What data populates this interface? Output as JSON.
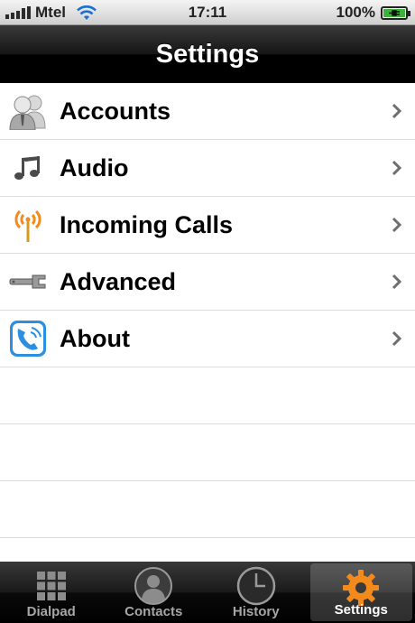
{
  "status_bar": {
    "carrier": "Mtel",
    "time": "17:11",
    "battery": "100%",
    "battery_level": 1.0,
    "signal_bars": 5,
    "icons": [
      "signal-icon",
      "wifi-icon",
      "battery-charging-icon"
    ]
  },
  "navbar": {
    "title": "Settings"
  },
  "settings": {
    "items": [
      {
        "label": "Accounts",
        "icon": "accounts-icon"
      },
      {
        "label": "Audio",
        "icon": "music-note-icon"
      },
      {
        "label": "Incoming Calls",
        "icon": "antenna-icon"
      },
      {
        "label": "Advanced",
        "icon": "wrench-icon"
      },
      {
        "label": "About",
        "icon": "app-phone-icon"
      }
    ]
  },
  "tabbar": {
    "tabs": [
      {
        "label": "Dialpad",
        "icon": "dialpad-icon",
        "active": false
      },
      {
        "label": "Contacts",
        "icon": "contacts-icon",
        "active": false
      },
      {
        "label": "History",
        "icon": "clock-icon",
        "active": false
      },
      {
        "label": "Settings",
        "icon": "gear-icon",
        "active": true
      }
    ]
  },
  "colors": {
    "accent_orange": "#f28a1c",
    "tab_inactive": "#a6a6a6",
    "battery_green": "#3cb43c"
  }
}
